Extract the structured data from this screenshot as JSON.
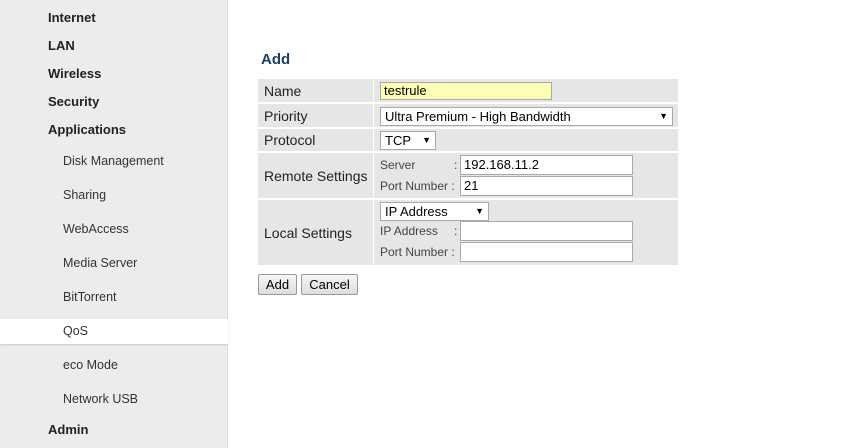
{
  "sidebar": {
    "items": [
      {
        "label": "Internet"
      },
      {
        "label": "LAN"
      },
      {
        "label": "Wireless"
      },
      {
        "label": "Security"
      },
      {
        "label": "Applications"
      },
      {
        "label": "Disk Management"
      },
      {
        "label": "Sharing"
      },
      {
        "label": "WebAccess"
      },
      {
        "label": "Media Server"
      },
      {
        "label": "BitTorrent"
      },
      {
        "label": "QoS",
        "active": true
      },
      {
        "label": "eco Mode"
      },
      {
        "label": "Network USB"
      },
      {
        "label": "Admin"
      }
    ]
  },
  "page": {
    "title": "Add"
  },
  "form": {
    "name": {
      "label": "Name",
      "value": "testrule"
    },
    "priority": {
      "label": "Priority",
      "value": "Ultra Premium - High Bandwidth"
    },
    "protocol": {
      "label": "Protocol",
      "value": "TCP"
    },
    "remote": {
      "label": "Remote Settings",
      "server_label": "Server",
      "server_value": "192.168.11.2",
      "port_label": "Port Number :",
      "port_value": "21"
    },
    "local": {
      "label": "Local Settings",
      "type_value": "IP Address",
      "ip_label": "IP Address",
      "ip_value": "",
      "port_label": "Port Number :",
      "port_value": ""
    },
    "colon": ":"
  },
  "buttons": {
    "add": "Add",
    "cancel": "Cancel"
  }
}
